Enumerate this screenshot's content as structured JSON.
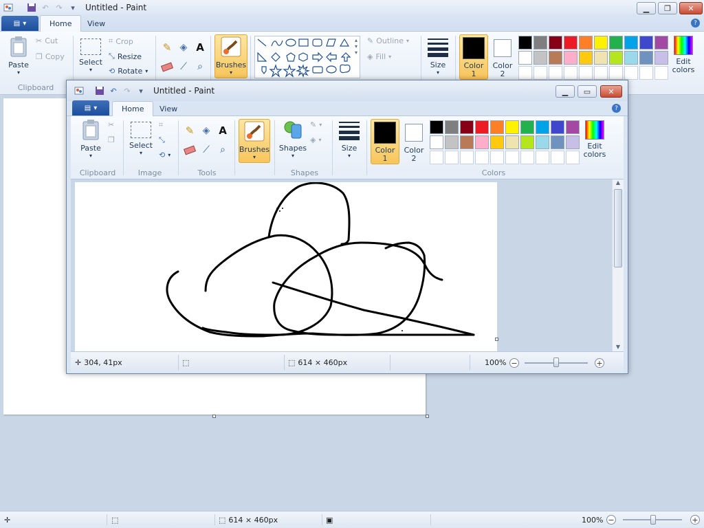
{
  "bg": {
    "title": "Untitled - Paint",
    "tabs": [
      "Home",
      "View"
    ],
    "clipboard": {
      "paste": "Paste",
      "cut": "Cut",
      "copy": "Copy",
      "group": "Clipboard"
    },
    "image": {
      "select": "Select",
      "crop": "Crop",
      "resize": "Resize",
      "rotate": "Rotate"
    },
    "brushes": "Brushes",
    "outline": "Outline",
    "fill": "Fill",
    "size": "Size",
    "color1": "Color\n1",
    "color2": "Color\n2",
    "edit_colors": "Edit\ncolors",
    "status": {
      "size": "614 × 460px",
      "zoom": "100%"
    }
  },
  "fg": {
    "title": "Untitled - Paint",
    "tabs": [
      "Home",
      "View"
    ],
    "paste": "Paste",
    "select": "Select",
    "brushes": "Brushes",
    "shapes": "Shapes",
    "size": "Size",
    "color1": "Color\n1",
    "color2": "Color\n2",
    "edit_colors": "Edit\ncolors",
    "groups": {
      "clipboard": "Clipboard",
      "image": "Image",
      "tools": "Tools",
      "shapes": "Shapes",
      "colors": "Colors"
    },
    "status": {
      "cursor": "304, 41px",
      "size": "614 × 460px",
      "zoom": "100%"
    }
  },
  "colors": {
    "row1": [
      "#000000",
      "#7f7f7f",
      "#880015",
      "#ed1c24",
      "#ff7f27",
      "#fff200",
      "#22b14c",
      "#00a2e8",
      "#3f48cc",
      "#a349a4"
    ],
    "row2": [
      "#ffffff",
      "#c3c3c3",
      "#b97a57",
      "#ffaec9",
      "#ffc90e",
      "#efe4b0",
      "#b5e61d",
      "#99d9ea",
      "#7092be",
      "#c8bfe7"
    ],
    "color1": "#000000",
    "color2": "#ffffff",
    "accent": "#f8c55c"
  }
}
